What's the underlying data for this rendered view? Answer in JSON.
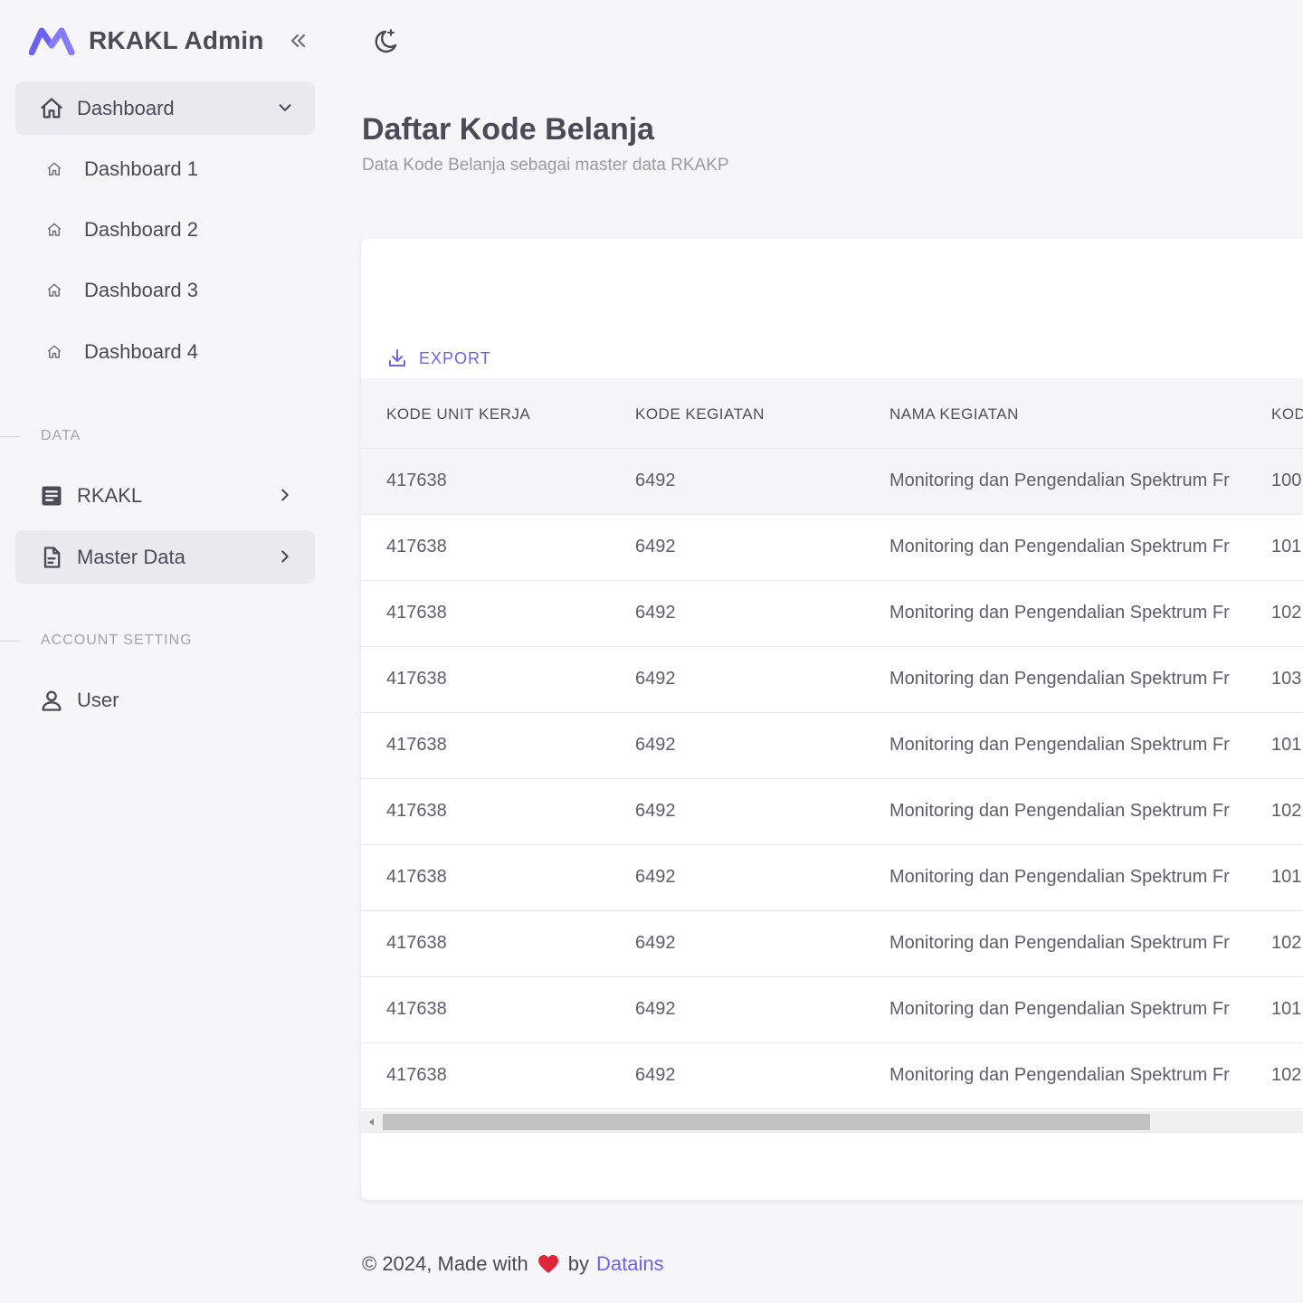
{
  "brand": {
    "title": "RKAKL Admin"
  },
  "sidebar": {
    "dashboard": {
      "label": "Dashboard",
      "children": [
        "Dashboard 1",
        "Dashboard 2",
        "Dashboard 3",
        "Dashboard 4"
      ]
    },
    "sections": [
      {
        "title": "DATA",
        "items": [
          {
            "label": "RKAKL",
            "icon": "document-list-icon"
          },
          {
            "label": "Master Data",
            "icon": "file-text-icon"
          }
        ]
      },
      {
        "title": "ACCOUNT SETTING",
        "items": [
          {
            "label": "User",
            "icon": "user-icon"
          }
        ]
      }
    ]
  },
  "page": {
    "title": "Daftar Kode Belanja",
    "subtitle": "Data Kode Belanja sebagai master data RKAKP"
  },
  "toolbar": {
    "export_label": "EXPORT"
  },
  "table": {
    "columns": [
      "KODE UNIT KERJA",
      "KODE KEGIATAN",
      "NAMA KEGIATAN",
      "KOD"
    ],
    "rows": [
      [
        "417638",
        "6492",
        "Monitoring dan Pengendalian Spektrum Fr",
        "100"
      ],
      [
        "417638",
        "6492",
        "Monitoring dan Pengendalian Spektrum Fr",
        "101"
      ],
      [
        "417638",
        "6492",
        "Monitoring dan Pengendalian Spektrum Fr",
        "102"
      ],
      [
        "417638",
        "6492",
        "Monitoring dan Pengendalian Spektrum Fr",
        "103"
      ],
      [
        "417638",
        "6492",
        "Monitoring dan Pengendalian Spektrum Fr",
        "101"
      ],
      [
        "417638",
        "6492",
        "Monitoring dan Pengendalian Spektrum Fr",
        "102"
      ],
      [
        "417638",
        "6492",
        "Monitoring dan Pengendalian Spektrum Fr",
        "101"
      ],
      [
        "417638",
        "6492",
        "Monitoring dan Pengendalian Spektrum Fr",
        "102"
      ],
      [
        "417638",
        "6492",
        "Monitoring dan Pengendalian Spektrum Fr",
        "101"
      ],
      [
        "417638",
        "6492",
        "Monitoring dan Pengendalian Spektrum Fr",
        "102"
      ]
    ]
  },
  "footer": {
    "prefix": "© 2024, Made with",
    "by": "by",
    "link": "Datains"
  },
  "colors": {
    "accent": "#6b63ef",
    "sidebar_active": "#e9e9ee",
    "background": "#f6f6f8",
    "heart": "#e0243a"
  }
}
